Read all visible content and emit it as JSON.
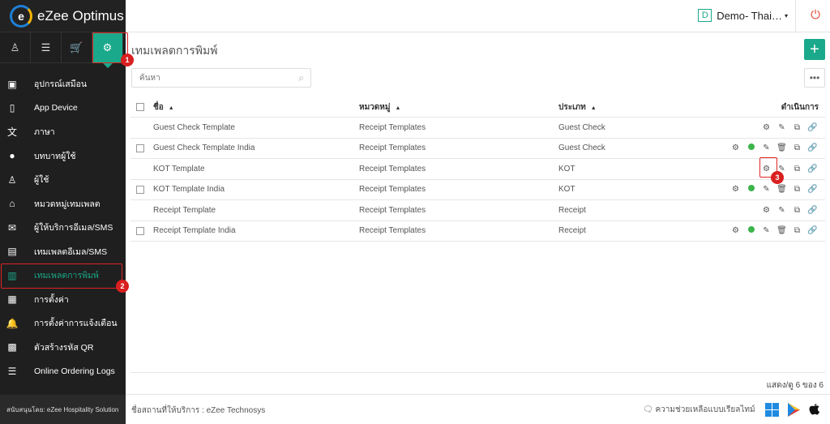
{
  "app": {
    "logo_text": "eZee Optimus",
    "logo_glyph": "e"
  },
  "header": {
    "property_badge": "D",
    "property_name": "Demo- Thai…",
    "caret": "▾",
    "power_icon": "⏻"
  },
  "sidebar": {
    "top_icons": [
      {
        "name": "user-icon",
        "glyph": "♙"
      },
      {
        "name": "menu-icon",
        "glyph": "☰"
      },
      {
        "name": "cart-icon",
        "glyph": "🛒"
      },
      {
        "name": "gear-icon",
        "glyph": "⚙"
      }
    ],
    "items": [
      {
        "label": "อุปกรณ์เสมือน",
        "icon": "▣"
      },
      {
        "label": "App Device",
        "icon": "▯"
      },
      {
        "label": "ภาษา",
        "icon": "文"
      },
      {
        "label": "บทบาทผู้ใช้",
        "icon": "●"
      },
      {
        "label": "ผู้ใช้",
        "icon": "♙"
      },
      {
        "label": "หมวดหมู่เทมเพลต",
        "icon": "⌂"
      },
      {
        "label": "ผู้ให้บริการอีเมล/SMS",
        "icon": "✉"
      },
      {
        "label": "เทมเพลตอีเมล/SMS",
        "icon": "▤"
      },
      {
        "label": "เทมเพลตการพิมพ์",
        "icon": "▥"
      },
      {
        "label": "การตั้งค่า",
        "icon": "▦"
      },
      {
        "label": "การตั้งค่าการแจ้งเตือน",
        "icon": "🔔"
      },
      {
        "label": "ตัวสร้างรหัส QR",
        "icon": "▩"
      },
      {
        "label": "Online Ordering Logs",
        "icon": "☰"
      }
    ],
    "footer": "สนับสนุนโดย: eZee Hospitality Solution"
  },
  "page": {
    "title": "เทมเพลตการพิมพ์",
    "add_label": "+",
    "more_label": "•••",
    "search_placeholder": "ค้นหา",
    "search_icon": "⌕"
  },
  "table": {
    "columns": {
      "name": "ชื่อ",
      "category": "หมวดหมู่",
      "type": "ประเภท",
      "actions": "ดำเนินการ",
      "sort": "▲"
    },
    "rows": [
      {
        "checkbox": false,
        "name": "Guest Check Template",
        "category": "Receipt Templates",
        "type": "Guest Check",
        "extended": false
      },
      {
        "checkbox": true,
        "name": "Guest Check Template India",
        "category": "Receipt Templates",
        "type": "Guest Check",
        "extended": true
      },
      {
        "checkbox": false,
        "name": "KOT Template",
        "category": "Receipt Templates",
        "type": "KOT",
        "extended": false
      },
      {
        "checkbox": true,
        "name": "KOT Template India",
        "category": "Receipt Templates",
        "type": "KOT",
        "extended": true
      },
      {
        "checkbox": false,
        "name": "Receipt Template",
        "category": "Receipt Templates",
        "type": "Receipt",
        "extended": false
      },
      {
        "checkbox": true,
        "name": "Receipt Template India",
        "category": "Receipt Templates",
        "type": "Receipt",
        "extended": true
      }
    ],
    "action_glyphs": {
      "settings": "⚙",
      "edit": "✎",
      "delete": "🗑",
      "copy": "⧉",
      "link": "🔗"
    },
    "status_color": "#3cb44b",
    "count_text": "แสดง/ดู 6 ของ 6"
  },
  "footer": {
    "service_name": "ชื่อสถานที่ให้บริการ : eZee Technosys",
    "help_text": "ความช่วยเหลือแบบเรียลไทม์",
    "help_icon": "🗨"
  },
  "annotations": [
    "1",
    "2",
    "3"
  ],
  "colors": {
    "accent": "#1aa98a",
    "power": "#e24b3b",
    "annotation": "#d92020"
  }
}
